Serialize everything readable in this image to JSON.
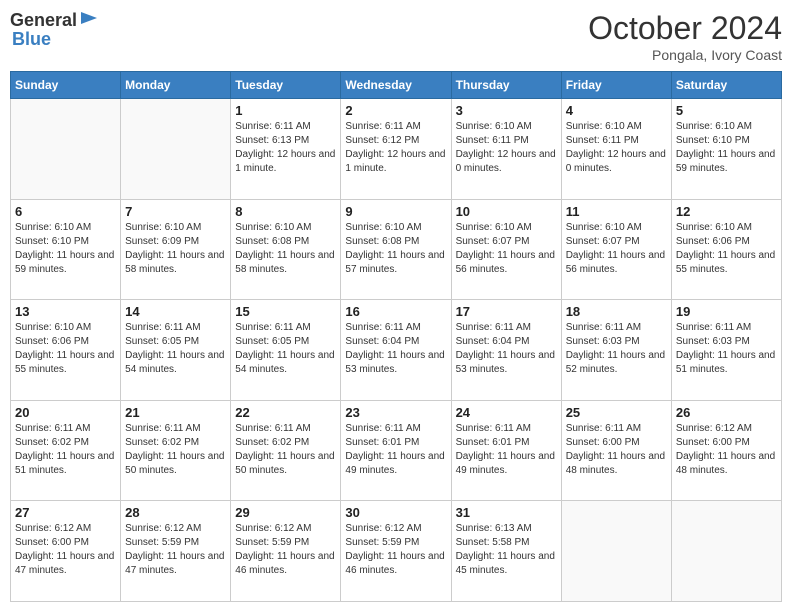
{
  "logo": {
    "general": "General",
    "blue": "Blue"
  },
  "header": {
    "month": "October 2024",
    "location": "Pongala, Ivory Coast"
  },
  "weekdays": [
    "Sunday",
    "Monday",
    "Tuesday",
    "Wednesday",
    "Thursday",
    "Friday",
    "Saturday"
  ],
  "weeks": [
    [
      {
        "day": "",
        "sunrise": "",
        "sunset": "",
        "daylight": ""
      },
      {
        "day": "",
        "sunrise": "",
        "sunset": "",
        "daylight": ""
      },
      {
        "day": "1",
        "sunrise": "Sunrise: 6:11 AM",
        "sunset": "Sunset: 6:13 PM",
        "daylight": "Daylight: 12 hours and 1 minute."
      },
      {
        "day": "2",
        "sunrise": "Sunrise: 6:11 AM",
        "sunset": "Sunset: 6:12 PM",
        "daylight": "Daylight: 12 hours and 1 minute."
      },
      {
        "day": "3",
        "sunrise": "Sunrise: 6:10 AM",
        "sunset": "Sunset: 6:11 PM",
        "daylight": "Daylight: 12 hours and 0 minutes."
      },
      {
        "day": "4",
        "sunrise": "Sunrise: 6:10 AM",
        "sunset": "Sunset: 6:11 PM",
        "daylight": "Daylight: 12 hours and 0 minutes."
      },
      {
        "day": "5",
        "sunrise": "Sunrise: 6:10 AM",
        "sunset": "Sunset: 6:10 PM",
        "daylight": "Daylight: 11 hours and 59 minutes."
      }
    ],
    [
      {
        "day": "6",
        "sunrise": "Sunrise: 6:10 AM",
        "sunset": "Sunset: 6:10 PM",
        "daylight": "Daylight: 11 hours and 59 minutes."
      },
      {
        "day": "7",
        "sunrise": "Sunrise: 6:10 AM",
        "sunset": "Sunset: 6:09 PM",
        "daylight": "Daylight: 11 hours and 58 minutes."
      },
      {
        "day": "8",
        "sunrise": "Sunrise: 6:10 AM",
        "sunset": "Sunset: 6:08 PM",
        "daylight": "Daylight: 11 hours and 58 minutes."
      },
      {
        "day": "9",
        "sunrise": "Sunrise: 6:10 AM",
        "sunset": "Sunset: 6:08 PM",
        "daylight": "Daylight: 11 hours and 57 minutes."
      },
      {
        "day": "10",
        "sunrise": "Sunrise: 6:10 AM",
        "sunset": "Sunset: 6:07 PM",
        "daylight": "Daylight: 11 hours and 56 minutes."
      },
      {
        "day": "11",
        "sunrise": "Sunrise: 6:10 AM",
        "sunset": "Sunset: 6:07 PM",
        "daylight": "Daylight: 11 hours and 56 minutes."
      },
      {
        "day": "12",
        "sunrise": "Sunrise: 6:10 AM",
        "sunset": "Sunset: 6:06 PM",
        "daylight": "Daylight: 11 hours and 55 minutes."
      }
    ],
    [
      {
        "day": "13",
        "sunrise": "Sunrise: 6:10 AM",
        "sunset": "Sunset: 6:06 PM",
        "daylight": "Daylight: 11 hours and 55 minutes."
      },
      {
        "day": "14",
        "sunrise": "Sunrise: 6:11 AM",
        "sunset": "Sunset: 6:05 PM",
        "daylight": "Daylight: 11 hours and 54 minutes."
      },
      {
        "day": "15",
        "sunrise": "Sunrise: 6:11 AM",
        "sunset": "Sunset: 6:05 PM",
        "daylight": "Daylight: 11 hours and 54 minutes."
      },
      {
        "day": "16",
        "sunrise": "Sunrise: 6:11 AM",
        "sunset": "Sunset: 6:04 PM",
        "daylight": "Daylight: 11 hours and 53 minutes."
      },
      {
        "day": "17",
        "sunrise": "Sunrise: 6:11 AM",
        "sunset": "Sunset: 6:04 PM",
        "daylight": "Daylight: 11 hours and 53 minutes."
      },
      {
        "day": "18",
        "sunrise": "Sunrise: 6:11 AM",
        "sunset": "Sunset: 6:03 PM",
        "daylight": "Daylight: 11 hours and 52 minutes."
      },
      {
        "day": "19",
        "sunrise": "Sunrise: 6:11 AM",
        "sunset": "Sunset: 6:03 PM",
        "daylight": "Daylight: 11 hours and 51 minutes."
      }
    ],
    [
      {
        "day": "20",
        "sunrise": "Sunrise: 6:11 AM",
        "sunset": "Sunset: 6:02 PM",
        "daylight": "Daylight: 11 hours and 51 minutes."
      },
      {
        "day": "21",
        "sunrise": "Sunrise: 6:11 AM",
        "sunset": "Sunset: 6:02 PM",
        "daylight": "Daylight: 11 hours and 50 minutes."
      },
      {
        "day": "22",
        "sunrise": "Sunrise: 6:11 AM",
        "sunset": "Sunset: 6:02 PM",
        "daylight": "Daylight: 11 hours and 50 minutes."
      },
      {
        "day": "23",
        "sunrise": "Sunrise: 6:11 AM",
        "sunset": "Sunset: 6:01 PM",
        "daylight": "Daylight: 11 hours and 49 minutes."
      },
      {
        "day": "24",
        "sunrise": "Sunrise: 6:11 AM",
        "sunset": "Sunset: 6:01 PM",
        "daylight": "Daylight: 11 hours and 49 minutes."
      },
      {
        "day": "25",
        "sunrise": "Sunrise: 6:11 AM",
        "sunset": "Sunset: 6:00 PM",
        "daylight": "Daylight: 11 hours and 48 minutes."
      },
      {
        "day": "26",
        "sunrise": "Sunrise: 6:12 AM",
        "sunset": "Sunset: 6:00 PM",
        "daylight": "Daylight: 11 hours and 48 minutes."
      }
    ],
    [
      {
        "day": "27",
        "sunrise": "Sunrise: 6:12 AM",
        "sunset": "Sunset: 6:00 PM",
        "daylight": "Daylight: 11 hours and 47 minutes."
      },
      {
        "day": "28",
        "sunrise": "Sunrise: 6:12 AM",
        "sunset": "Sunset: 5:59 PM",
        "daylight": "Daylight: 11 hours and 47 minutes."
      },
      {
        "day": "29",
        "sunrise": "Sunrise: 6:12 AM",
        "sunset": "Sunset: 5:59 PM",
        "daylight": "Daylight: 11 hours and 46 minutes."
      },
      {
        "day": "30",
        "sunrise": "Sunrise: 6:12 AM",
        "sunset": "Sunset: 5:59 PM",
        "daylight": "Daylight: 11 hours and 46 minutes."
      },
      {
        "day": "31",
        "sunrise": "Sunrise: 6:13 AM",
        "sunset": "Sunset: 5:58 PM",
        "daylight": "Daylight: 11 hours and 45 minutes."
      },
      {
        "day": "",
        "sunrise": "",
        "sunset": "",
        "daylight": ""
      },
      {
        "day": "",
        "sunrise": "",
        "sunset": "",
        "daylight": ""
      }
    ]
  ]
}
